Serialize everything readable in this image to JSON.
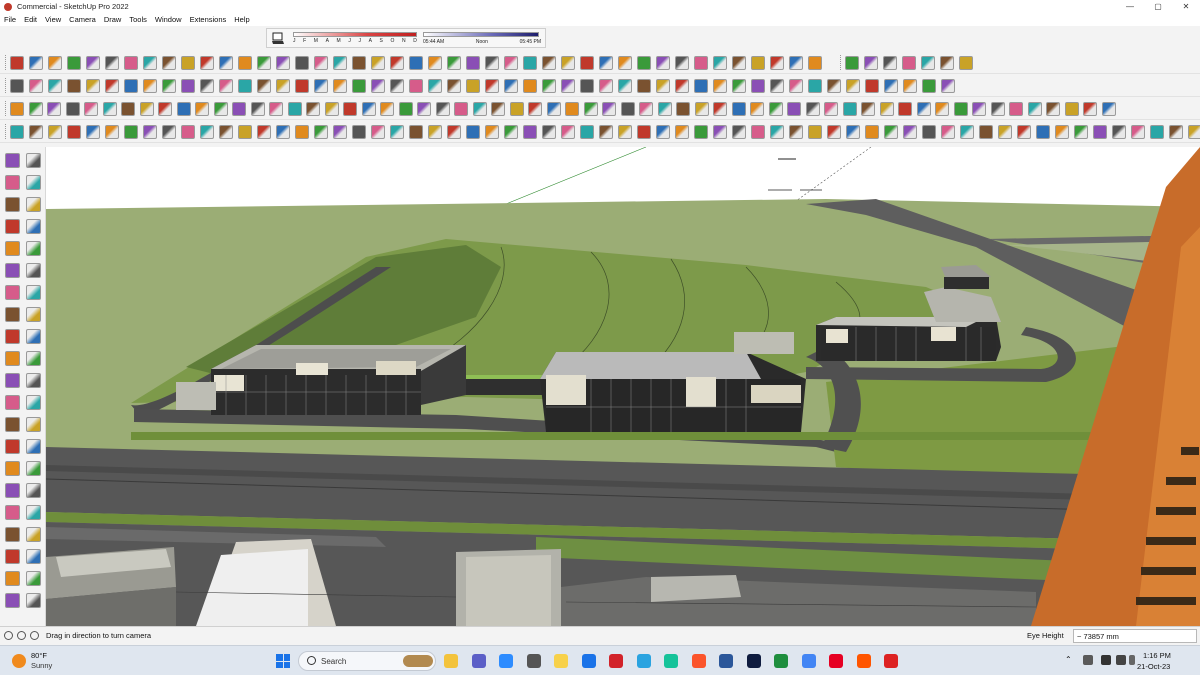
{
  "window": {
    "title": "Commercial - SketchUp Pro 2022",
    "minimize": "—",
    "maximize": "▢",
    "close": "✕"
  },
  "menu": [
    "File",
    "Edit",
    "View",
    "Camera",
    "Draw",
    "Tools",
    "Window",
    "Extensions",
    "Help"
  ],
  "shadows": {
    "months": [
      "J",
      "F",
      "M",
      "A",
      "M",
      "J",
      "J",
      "A",
      "S",
      "O",
      "N",
      "D"
    ],
    "time_start": "05:44 AM",
    "time_mid": "Noon",
    "time_end": "05:45 PM"
  },
  "status": {
    "hint": "Drag in direction to turn camera",
    "measure_label": "Eye Height",
    "measure_value": "~ 73857 mm"
  },
  "taskbar": {
    "weather_temp": "80°F",
    "weather_condition": "Sunny",
    "search_placeholder": "Search",
    "time": "1:16 PM",
    "date": "21-Oct-23",
    "pinned_apps": [
      "file-explorer-icon",
      "teams-icon",
      "zoom-icon",
      "calculator-icon",
      "sticky-notes-icon",
      "store-icon",
      "opera-icon",
      "telegram-icon",
      "grammarly-icon",
      "brave-icon",
      "word-icon",
      "photoshop-icon",
      "google-drive-icon",
      "chrome-icon",
      "pinterest-icon",
      "soundcloud-icon",
      "sketchup-icon"
    ]
  },
  "colors": {
    "grass_dark": "#5f7d39",
    "grass_light": "#7d9a4a",
    "road": "#5a5a5a",
    "ground": "#9bad75",
    "facade_tower": "#c86c2a"
  }
}
